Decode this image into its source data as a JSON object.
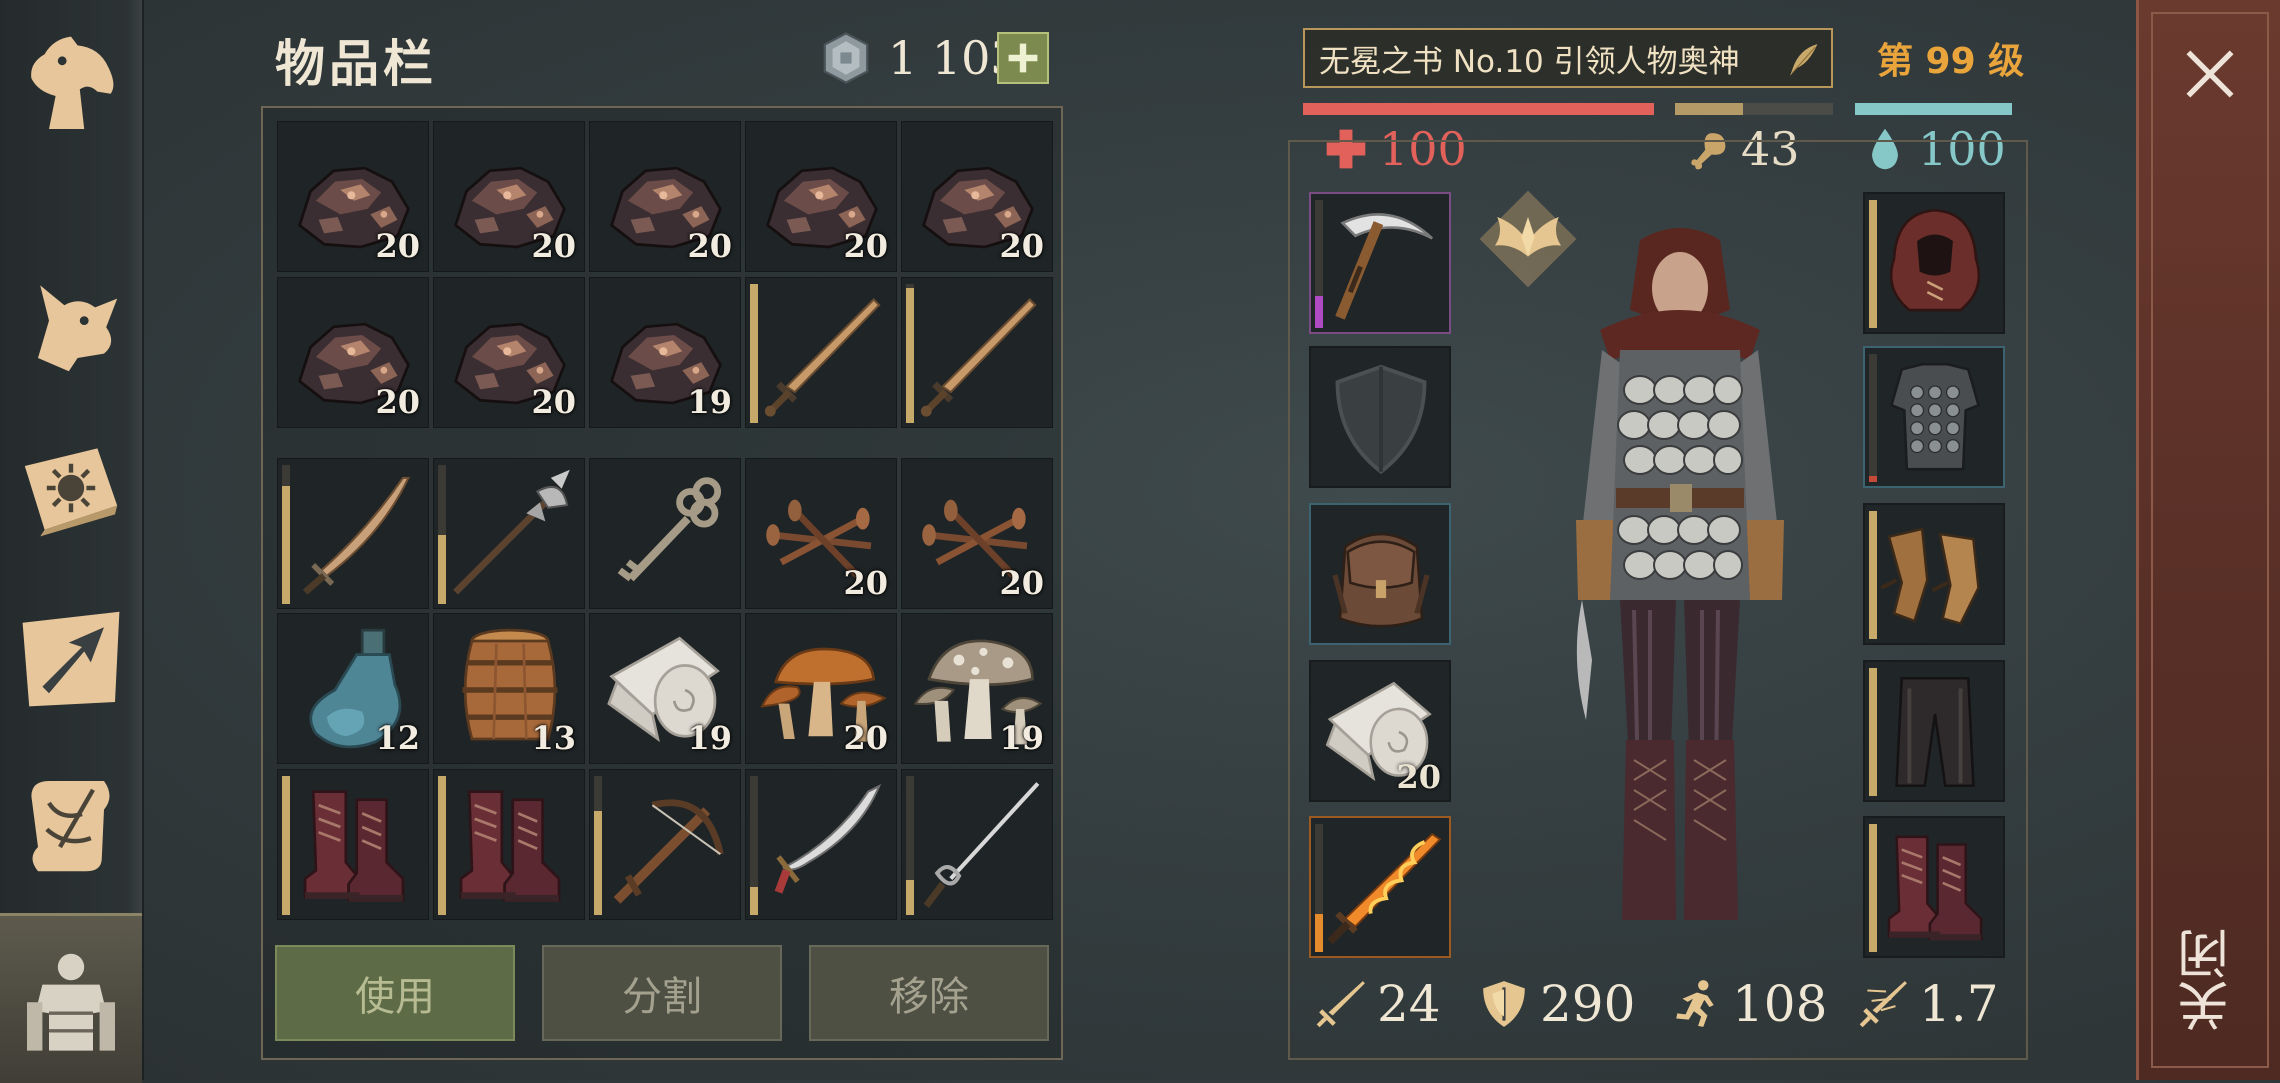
{
  "nav": {
    "items": [
      {
        "name": "horse-icon"
      },
      {
        "name": "wolf-icon"
      },
      {
        "name": "sun-book-icon"
      },
      {
        "name": "map-arrow-icon"
      },
      {
        "name": "scroll-quill-icon"
      },
      {
        "name": "character-armor-icon",
        "active": true
      }
    ]
  },
  "inventory": {
    "title": "物品栏",
    "currency": {
      "icon": "silver-coin-icon",
      "amount": "1 103",
      "add_icon": "plus-icon"
    },
    "slots": [
      {
        "item": "iron-ore-icon",
        "qty": "20"
      },
      {
        "item": "iron-ore-icon",
        "qty": "20"
      },
      {
        "item": "iron-ore-icon",
        "qty": "20"
      },
      {
        "item": "iron-ore-icon",
        "qty": "20"
      },
      {
        "item": "iron-ore-icon",
        "qty": "20"
      },
      {
        "item": "iron-ore-icon",
        "qty": "20"
      },
      {
        "item": "iron-ore-icon",
        "qty": "20"
      },
      {
        "item": "iron-ore-icon",
        "qty": "19"
      },
      {
        "item": "bronze-sword-icon",
        "durability": 1.0
      },
      {
        "item": "bronze-sword-icon",
        "durability": 0.97
      },
      {
        "item": "curved-sword-icon",
        "durability": 0.85
      },
      {
        "item": "halberd-icon",
        "durability": 0.5
      },
      {
        "item": "iron-key-icon"
      },
      {
        "item": "nails-icon",
        "qty": "20"
      },
      {
        "item": "nails-icon",
        "qty": "20"
      },
      {
        "item": "glass-flask-icon",
        "qty": "12"
      },
      {
        "item": "wooden-barrel-icon",
        "qty": "13"
      },
      {
        "item": "cloth-roll-icon",
        "qty": "19"
      },
      {
        "item": "orange-mushroom-icon",
        "qty": "20"
      },
      {
        "item": "spotted-mushroom-icon",
        "qty": "19"
      },
      {
        "item": "leather-boots-icon",
        "durability": 1.0
      },
      {
        "item": "leather-boots-icon",
        "durability": 1.0
      },
      {
        "item": "crossbow-icon",
        "durability": 0.75
      },
      {
        "item": "scimitar-icon",
        "durability": 0.2
      },
      {
        "item": "rapier-icon",
        "durability": 0.25
      }
    ],
    "buttons": {
      "use": "使用",
      "split": "分割",
      "remove": "移除"
    }
  },
  "character": {
    "book_title": "无冕之书 No.10 引领人物奥神",
    "book_icon": "quill-icon",
    "level": "第 99 级",
    "health": {
      "value": "100",
      "fraction": 1.0,
      "color": "#e2625b",
      "icon": "health-cross-icon"
    },
    "food": {
      "value": "43",
      "fraction": 0.43,
      "color": "#b39a66",
      "icon": "drumstick-icon"
    },
    "water": {
      "value": "100",
      "fraction": 1.0,
      "color": "#86c7c8",
      "icon": "water-drop-icon"
    },
    "badge_icon": "winged-emblem-icon",
    "left_slots": [
      {
        "item": "pickaxe-icon",
        "durability": 0.25,
        "border": "#7b4c83",
        "dur_color": "#b04ac2"
      },
      {
        "item": "shield-placeholder-icon"
      },
      {
        "item": "backpack-icon",
        "border": "#3c6470"
      },
      {
        "item": "cloth-roll-icon",
        "qty": "20"
      },
      {
        "item": "flame-sword-icon",
        "durability": 0.3,
        "border": "#9a5a22",
        "dur_color": "#e38b2d"
      }
    ],
    "right_slots": [
      {
        "item": "hood-icon",
        "durability": 1.0
      },
      {
        "item": "scale-armor-icon",
        "durability": 0.05,
        "border": "#3c6470",
        "dur_color": "#c44a3a"
      },
      {
        "item": "leather-gloves-icon",
        "durability": 1.0
      },
      {
        "item": "leather-pants-icon",
        "durability": 1.0
      },
      {
        "item": "leather-boots-icon",
        "durability": 1.0
      }
    ],
    "stats": [
      {
        "icon": "attack-sword-icon",
        "value": "24"
      },
      {
        "icon": "armor-shield-icon",
        "value": "290"
      },
      {
        "icon": "running-speed-icon",
        "value": "108"
      },
      {
        "icon": "attack-speed-icon",
        "value": "1.7"
      }
    ]
  },
  "close": {
    "label": "关闭",
    "icon": "close-x-icon"
  }
}
